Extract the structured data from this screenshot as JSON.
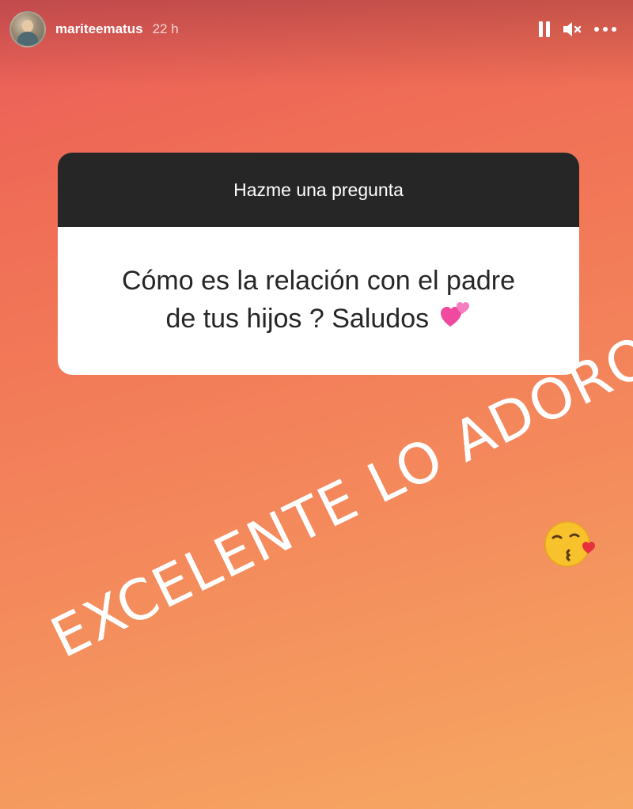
{
  "story": {
    "username": "mariteematus",
    "timestamp": "22 h",
    "controls": {
      "pause_icon": "pause-icon",
      "mute_icon": "speaker-muted-icon",
      "more_icon": "more-dots-icon"
    }
  },
  "question_sticker": {
    "title": "Hazme una pregunta",
    "question_line1": "Cómo es la relación con el padre",
    "question_line2": "de tus hijos ? Saludos",
    "emoji": "two-hearts-emoji"
  },
  "answer": {
    "text": "EXCELENTE LO ADORO",
    "emoji": "face-blowing-kiss-emoji"
  },
  "colors": {
    "gradient_start": "#e85c5a",
    "gradient_end": "#f6a863",
    "sticker_header": "#262626",
    "sticker_body": "#ffffff"
  }
}
